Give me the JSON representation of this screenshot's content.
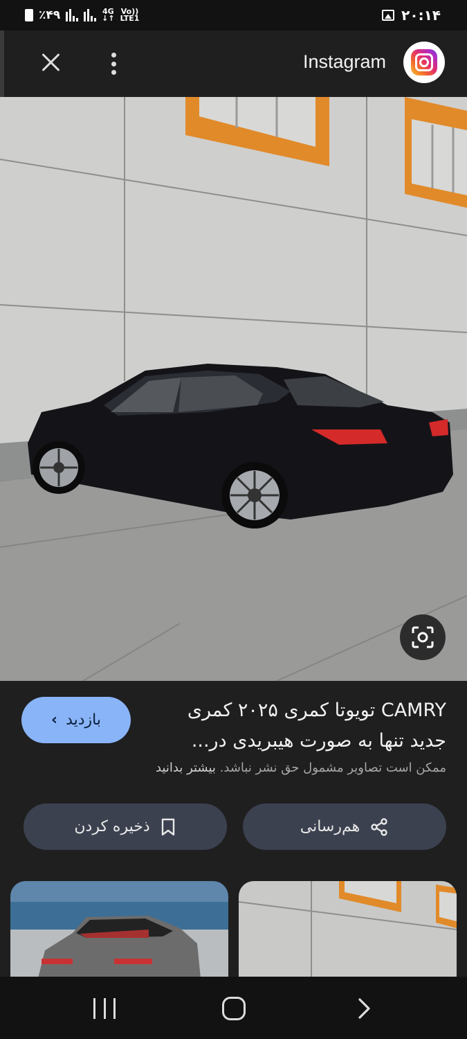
{
  "status_bar": {
    "battery": "٪۴۹",
    "network_top": "4G",
    "network_bottom": "↓↑",
    "volte_top": "Vo))",
    "volte_bottom": "LTE1",
    "time": "۲۰:۱۴"
  },
  "top_bar": {
    "site_name": "Instagram",
    "close_icon": "close-icon",
    "more_icon": "more-vert-icon"
  },
  "result": {
    "title_line1": "CAMRY تویوتا کمری ۲۰۲۵ کمری",
    "title_line2": "جدید تنها به صورت هیبریدی در...",
    "copyright_notice": "ممکن است تصاویر مشمول حق نشر نباشد.",
    "learn_more": "بیشتر بدانید",
    "visit_label": "بازدید",
    "share_label": "هم‌رسانی",
    "save_label": "ذخیره کردن"
  },
  "colors": {
    "background": "#1f1f1f",
    "visit_button": "#8ab4f8",
    "action_button": "#3c4150",
    "status_bar": "#121212"
  },
  "icons": [
    "close-icon",
    "more-vert-icon",
    "instagram-logo",
    "lens-icon",
    "chevron-left-icon",
    "share-icon",
    "bookmark-icon",
    "recents-icon",
    "home-icon",
    "back-icon"
  ]
}
